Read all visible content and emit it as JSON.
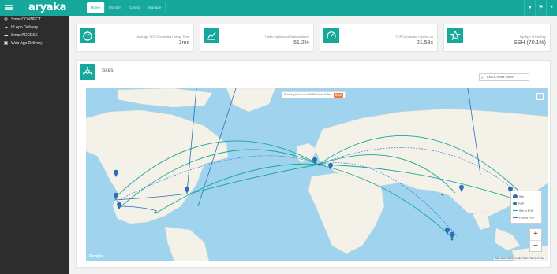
{
  "app": {
    "logo": "aryaka"
  },
  "tabs": [
    {
      "label": "Home"
    },
    {
      "label": "Monitor"
    },
    {
      "label": "Config"
    },
    {
      "label": "Manage"
    }
  ],
  "sidebar": {
    "items": [
      {
        "label": "SmartCONNECT",
        "icon": "globe-icon"
      },
      {
        "label": "IP App Delivery",
        "icon": "cloud-icon"
      },
      {
        "label": "SmartACCESS",
        "icon": "cloud-icon"
      },
      {
        "label": "Web App Delivery",
        "icon": "browser-icon"
      }
    ]
  },
  "kpis": [
    {
      "label": "Average TCP Connection Setup Time",
      "value": "3ms",
      "icon": "stopwatch-icon"
    },
    {
      "label": "Traffic Optimized/Reduced/wide",
      "value": "51.2%",
      "icon": "chart-trend-icon"
    },
    {
      "label": "TCP Connection Speed-up",
      "value": "21.58x",
      "icon": "gauge-icon"
    },
    {
      "label": "Top App of the Day",
      "value": "SSH (70.1%)",
      "icon": "star-icon"
    }
  ],
  "sites": {
    "title": "Sites",
    "search_value": "EMEA-Head Office",
    "banner_text": "Showing lines from EMEA-Head Office",
    "banner_button": "Back",
    "legend": [
      {
        "label": "Site",
        "color": "#2f6db5"
      },
      {
        "label": "POP",
        "color": "#1f8a70"
      },
      {
        "label": "Site to POP",
        "color": "#16a89a"
      },
      {
        "label": "POP to POP",
        "color": "#3a7bd5"
      }
    ],
    "zoom_in": "+",
    "zoom_out": "−",
    "map_brand": "Google",
    "map_terms": "Map data ©2015 Google, INEGI   Terms of Use"
  },
  "colors": {
    "accent": "#16a89a",
    "sidebar": "#2d2d2d",
    "ocean": "#9fd3ee",
    "land": "#f4f1e8"
  }
}
